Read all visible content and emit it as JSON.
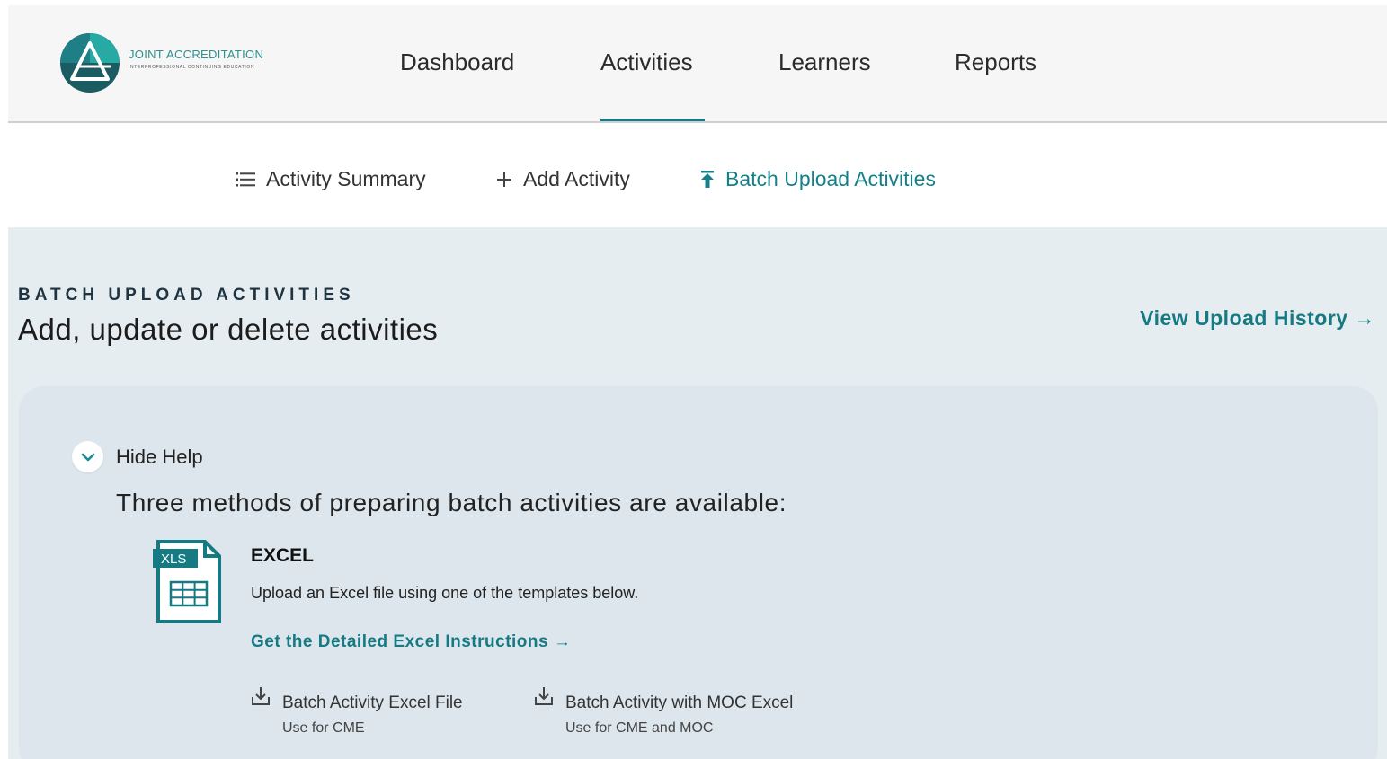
{
  "brand": {
    "name": "JOINT ACCREDITATION",
    "tagline": "INTERPROFESSIONAL CONTINUING EDUCATION",
    "colors": {
      "teal": "#157a82",
      "logo_dark": "#1b5c63",
      "logo_light": "#27a9a4"
    }
  },
  "nav": {
    "items": [
      {
        "label": "Dashboard"
      },
      {
        "label": "Activities",
        "active": true
      },
      {
        "label": "Learners"
      },
      {
        "label": "Reports"
      }
    ]
  },
  "subnav": {
    "items": [
      {
        "label": "Activity Summary",
        "icon": "list-icon"
      },
      {
        "label": "Add Activity",
        "icon": "plus-icon"
      },
      {
        "label": "Batch Upload Activities",
        "icon": "upload-icon",
        "active": true
      }
    ]
  },
  "page": {
    "eyebrow": "BATCH UPLOAD ACTIVITIES",
    "title": "Add, update or delete activities",
    "history_link": "View Upload History →"
  },
  "help": {
    "toggle_label": "Hide Help",
    "heading": "Three methods of preparing batch activities are available:",
    "excel": {
      "badge": "XLS",
      "title": "EXCEL",
      "description": "Upload an Excel file using one of the templates below.",
      "instructions_link": "Get the Detailed Excel Instructions →",
      "downloads": [
        {
          "title": "Batch Activity Excel File",
          "subtitle": "Use for CME",
          "icon": "download-icon"
        },
        {
          "title": "Batch Activity with MOC Excel",
          "subtitle": "Use for CME and MOC",
          "icon": "download-icon"
        }
      ]
    }
  }
}
